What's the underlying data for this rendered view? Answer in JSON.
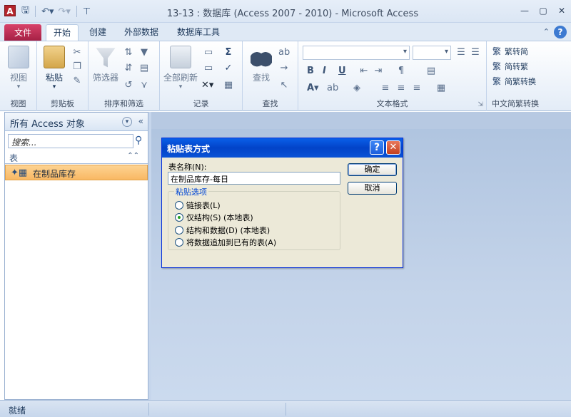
{
  "window": {
    "app_icon_letter": "A",
    "title": "13-13 : 数据库 (Access 2007 - 2010)  -  Microsoft Access",
    "controls": [
      "—",
      "▢",
      "✕"
    ]
  },
  "tabs": {
    "file": "文件",
    "home": "开始",
    "create": "创建",
    "external": "外部数据",
    "dbtools": "数据库工具"
  },
  "ribbon": {
    "view": {
      "button": "视图",
      "group": "视图"
    },
    "clipboard": {
      "paste": "粘贴",
      "group": "剪贴板"
    },
    "sort": {
      "filter": "筛选器",
      "group": "排序和筛选"
    },
    "records": {
      "refresh": "全部刷新",
      "group": "记录"
    },
    "find": {
      "find": "查找",
      "group": "查找"
    },
    "text": {
      "group": "文本格式"
    },
    "convert": {
      "trad": "繁转简",
      "simp": "简转繁",
      "both": "简繁转换",
      "group": "中文简繁转换"
    }
  },
  "nav": {
    "title": "所有 Access 对象",
    "search_placeholder": "搜索...",
    "group_label": "表",
    "item": "在制品库存"
  },
  "dialog": {
    "title": "粘贴表方式",
    "table_name_label": "表名称(N):",
    "table_name_value": "在制品库存-每日",
    "ok": "确定",
    "cancel": "取消",
    "options_legend": "粘贴选项",
    "options": [
      {
        "label": "链接表(L)",
        "checked": false
      },
      {
        "label": "仅结构(S)  (本地表)",
        "checked": true
      },
      {
        "label": "结构和数据(D)  (本地表)",
        "checked": false
      },
      {
        "label": "将数据追加到已有的表(A)",
        "checked": false
      }
    ]
  },
  "status": {
    "text": "就绪"
  },
  "colors": {
    "file_tab": "#b8274e",
    "dialog_title": "#0a4fd4",
    "selected_item": "#f9c374"
  }
}
